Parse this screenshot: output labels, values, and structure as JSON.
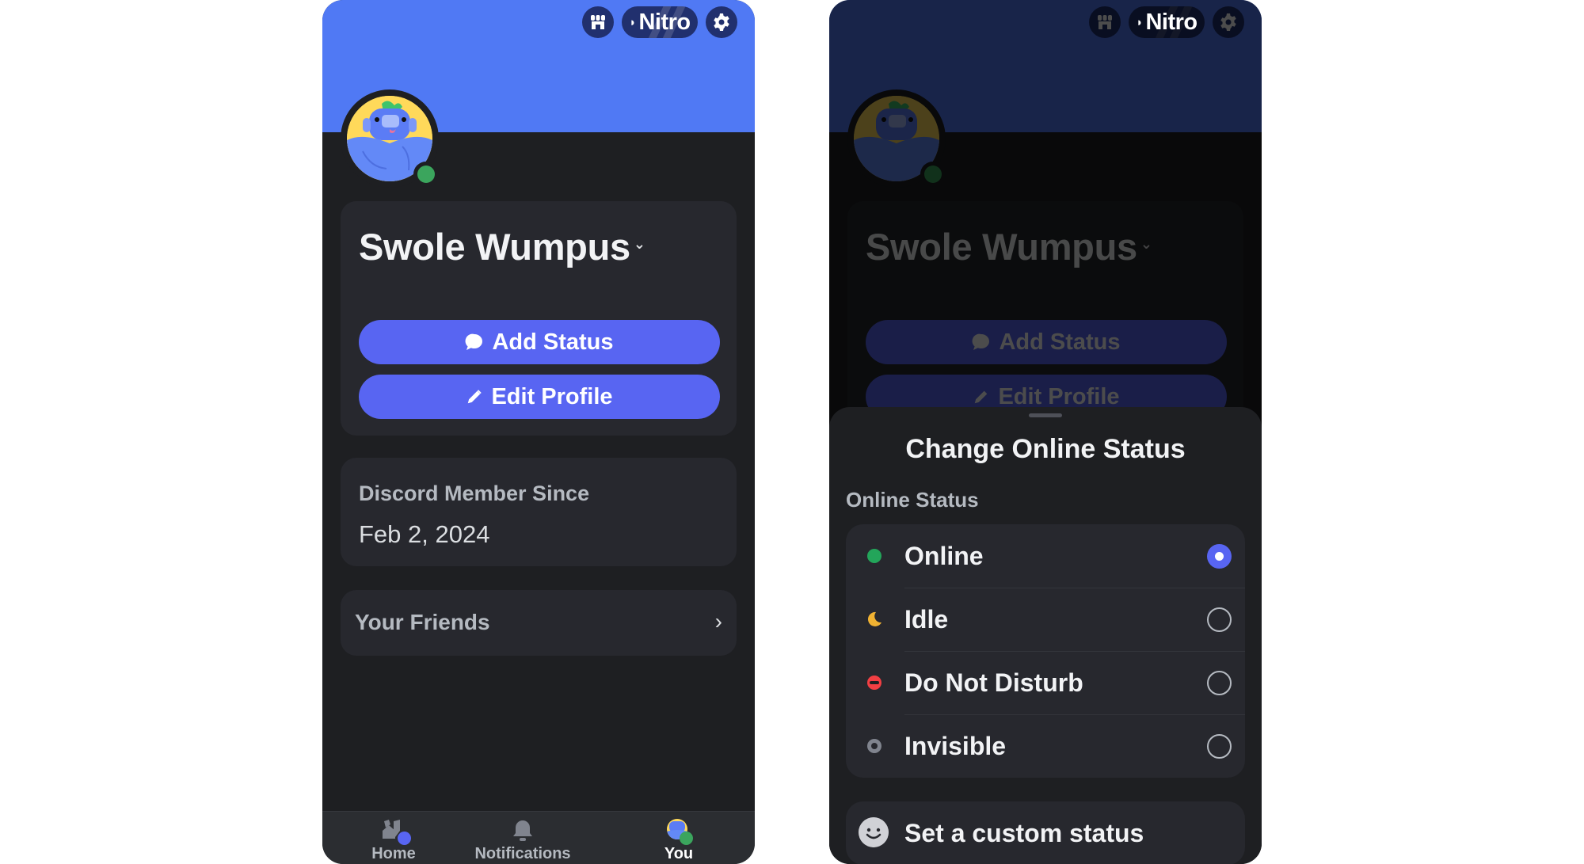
{
  "profile_screen": {
    "header": {
      "shop_icon": "shop-icon",
      "nitro_label": "Nitro",
      "nitro_icon": "nitro-icon",
      "settings_icon": "gear-icon"
    },
    "user": {
      "display_name": "Swole Wumpus",
      "status": "online",
      "status_color": "#3ba55d"
    },
    "actions": {
      "add_status_label": "Add Status",
      "edit_profile_label": "Edit Profile"
    },
    "member_since": {
      "label": "Discord Member Since",
      "date": "Feb 2, 2024"
    },
    "friends": {
      "label": "Your Friends",
      "chevron": "›"
    },
    "bottom_nav": {
      "items": [
        {
          "label": "Home",
          "icon": "home-icon",
          "badge_color": "#5865f2",
          "active": false
        },
        {
          "label": "Notifications",
          "icon": "bell-icon",
          "active": false
        },
        {
          "label": "You",
          "icon": "avatar-icon",
          "badge_color": "#3ba55d",
          "active": true
        }
      ]
    }
  },
  "status_sheet": {
    "title": "Change Online Status",
    "section_label": "Online Status",
    "options": [
      {
        "label": "Online",
        "icon": "online-dot-icon",
        "color": "#23a55a",
        "selected": true
      },
      {
        "label": "Idle",
        "icon": "moon-icon",
        "color": "#f0b232",
        "selected": false
      },
      {
        "label": "Do Not Disturb",
        "icon": "dnd-icon",
        "color": "#f23f43",
        "selected": false
      },
      {
        "label": "Invisible",
        "icon": "invisible-icon",
        "color": "#80848e",
        "selected": false
      }
    ],
    "custom_status_label": "Set a custom status",
    "custom_status_icon": "smiley-icon"
  },
  "colors": {
    "banner": "#5079f4",
    "blurple": "#5865f2",
    "background": "#1e1f22",
    "card": "#27282e"
  }
}
